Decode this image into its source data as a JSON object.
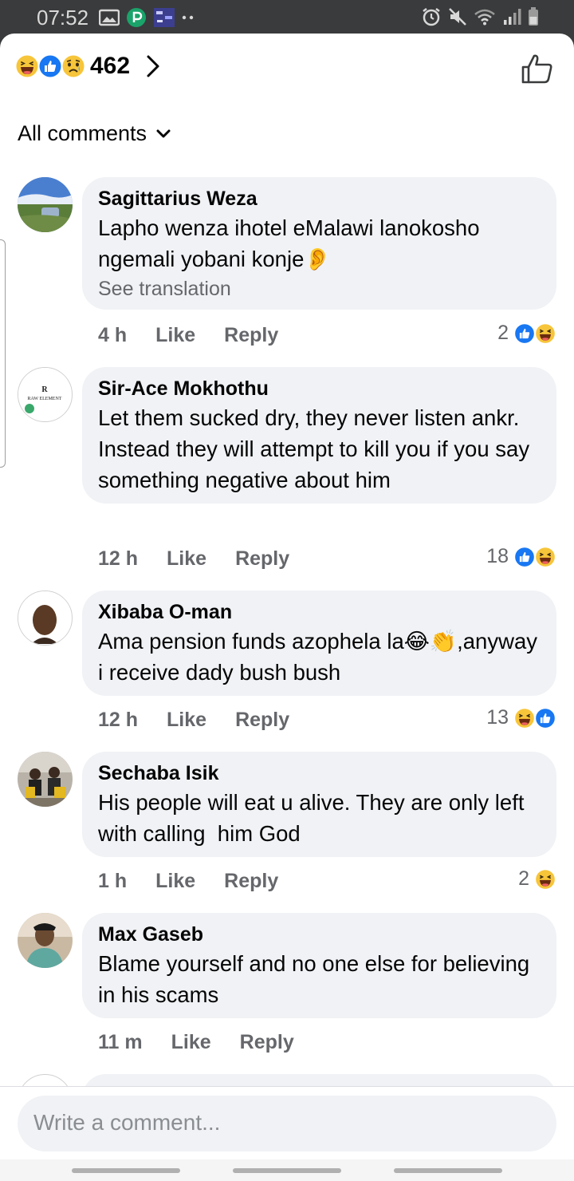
{
  "status_bar": {
    "time": "07:52",
    "left_icons": [
      "gallery-icon",
      "p-app-icon",
      "tv-icon",
      "more-dots-icon"
    ],
    "right_icons": [
      "alarm-icon",
      "mute-icon",
      "wifi-icon",
      "signal-icon",
      "battery-icon"
    ]
  },
  "header": {
    "reaction_types": [
      "haha",
      "like",
      "sad"
    ],
    "reaction_count": "462"
  },
  "filter": {
    "label": "All comments"
  },
  "comments": [
    {
      "author": "Sagittarius Weza",
      "text": "Lapho wenza ihotel eMalawi lanokosho ngemali yobani konje👂",
      "see_translation": "See translation",
      "time": "4 h",
      "like": "Like",
      "reply": "Reply",
      "reaction_count": "2",
      "reactions": [
        "like",
        "haha"
      ]
    },
    {
      "author": "Sir-Ace Mokhothu",
      "text": "Let them sucked dry, they never listen ankr. Instead they will attempt to kill you if you say something negative about him",
      "time": "12 h",
      "like": "Like",
      "reply": "Reply",
      "reaction_count": "18",
      "reactions": [
        "like",
        "haha"
      ]
    },
    {
      "author": "Xibaba O-man",
      "text": "Ama pension funds azophela la😂👏,anyway i receive dady bush bush",
      "time": "12 h",
      "like": "Like",
      "reply": "Reply",
      "reaction_count": "13",
      "reactions": [
        "haha",
        "like"
      ]
    },
    {
      "author": "Sechaba Isik",
      "text": "His people will eat u alive. They are only left   with calling  him God",
      "time": "1 h",
      "like": "Like",
      "reply": "Reply",
      "reaction_count": "2",
      "reactions": [
        "haha"
      ]
    },
    {
      "author": "Max Gaseb",
      "text": "Blame yourself and no one else for believing in his scams",
      "time": "11 m",
      "like": "Like",
      "reply": "Reply"
    }
  ],
  "composer": {
    "placeholder": "Write a comment..."
  },
  "colors": {
    "like_blue": "#1877f2",
    "haha_yellow": "#f7c53a",
    "bubble_gray": "#f0f2f5",
    "meta_gray": "#65676b"
  }
}
